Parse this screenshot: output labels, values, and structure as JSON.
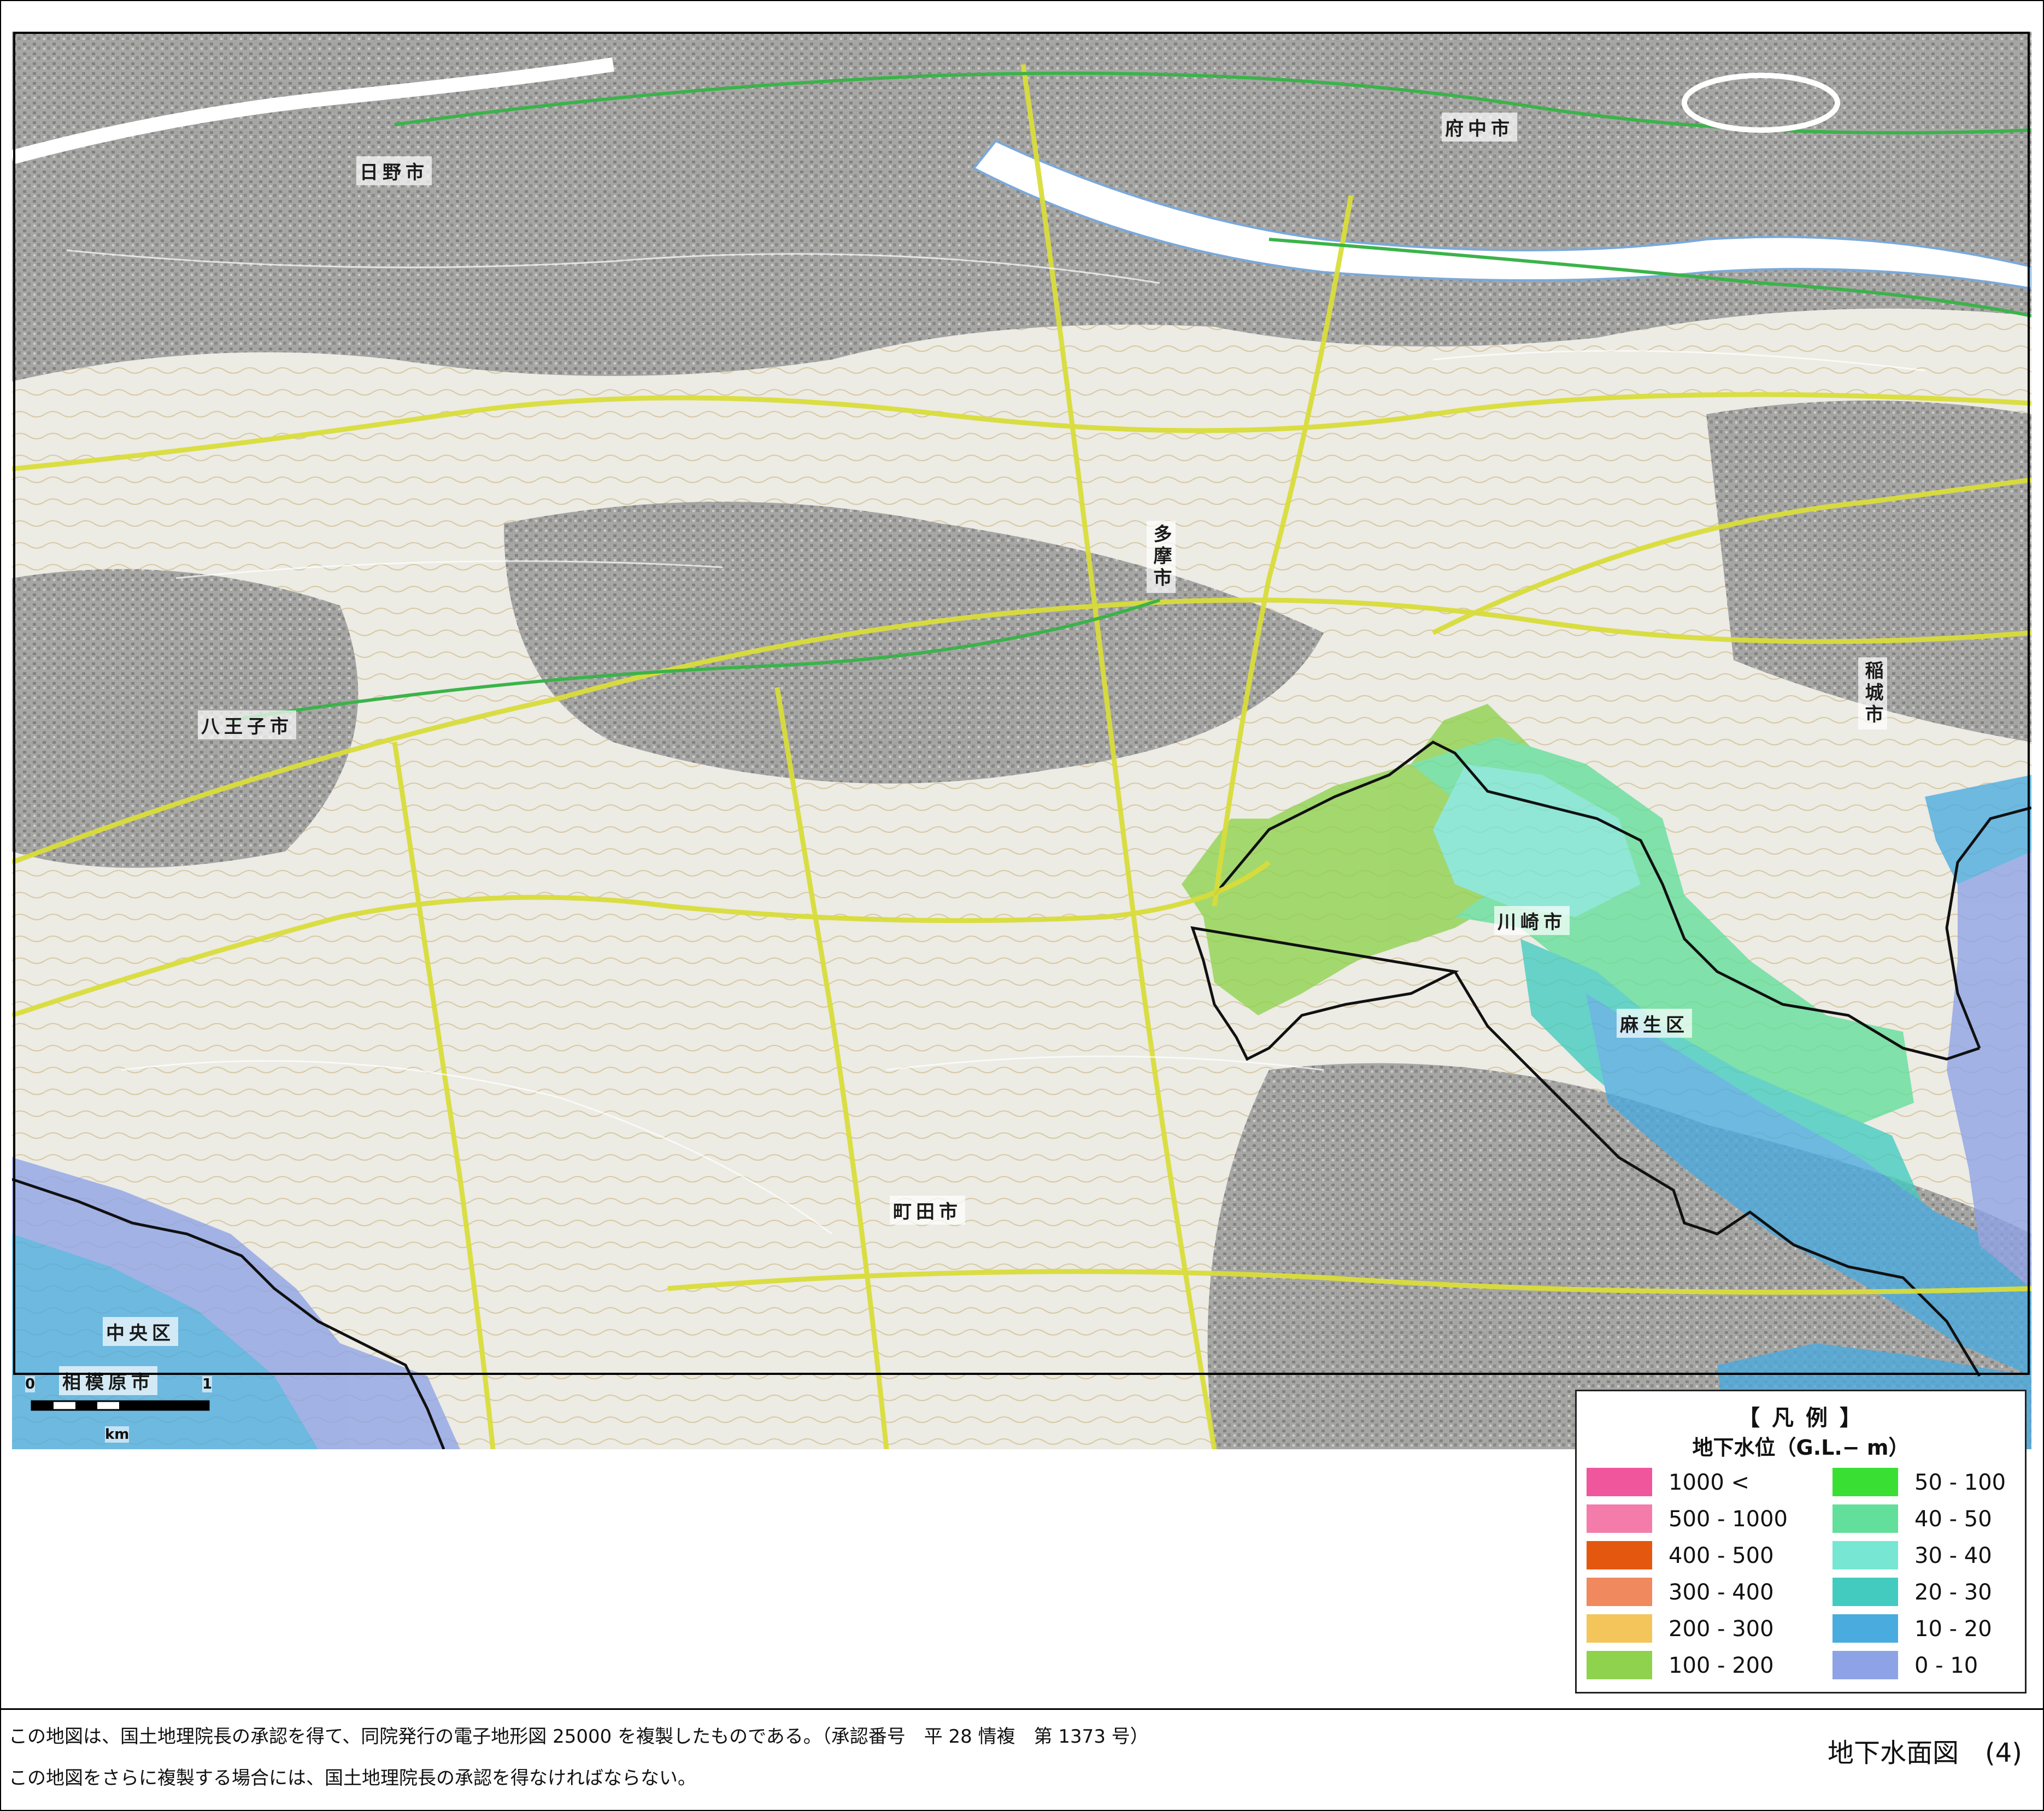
{
  "map": {
    "city_labels": [
      {
        "id": "hino",
        "text": "日野市"
      },
      {
        "id": "fuchu",
        "text": "府中市"
      },
      {
        "id": "tama",
        "text": "多摩市"
      },
      {
        "id": "hachioji",
        "text": "八王子市"
      },
      {
        "id": "inagi",
        "text": "稲城市"
      },
      {
        "id": "kawasaki",
        "text": "川崎市"
      },
      {
        "id": "asao",
        "text": "麻生区"
      },
      {
        "id": "machida",
        "text": "町田市"
      },
      {
        "id": "chuo",
        "text": "中央区"
      },
      {
        "id": "sagamihara",
        "text": "相模原市"
      }
    ],
    "colors": {
      "terrain": "#e9e9e6",
      "urban": "#8f8f8f",
      "road": "#d9dd3a",
      "river": "#ffffff",
      "rail": "#3bb34a"
    }
  },
  "scalebar": {
    "zero": "0",
    "one": "1",
    "unit": "km"
  },
  "legend": {
    "title": "【 凡 例 】",
    "subtitle": "地下水位（G.L.− m）",
    "items": [
      {
        "label": "1000 <",
        "color": "#f0569b"
      },
      {
        "label": "500 - 1000",
        "color": "#f47cab"
      },
      {
        "label": "400 - 500",
        "color": "#e4570f"
      },
      {
        "label": "300 - 400",
        "color": "#f0895e"
      },
      {
        "label": "200 - 300",
        "color": "#f3c55a"
      },
      {
        "label": "100 - 200",
        "color": "#8ed24d"
      },
      {
        "label": "50 - 100",
        "color": "#39e033"
      },
      {
        "label": "40 - 50",
        "color": "#62df9a"
      },
      {
        "label": "30 - 40",
        "color": "#77e6d3"
      },
      {
        "label": "20 - 30",
        "color": "#43cbc0"
      },
      {
        "label": "10 - 20",
        "color": "#4aabdf"
      },
      {
        "label": "0 - 10",
        "color": "#8ea3e6"
      }
    ]
  },
  "footer": {
    "credit_line1": "この地図は、国土地理院長の承認を得て、同院発行の電子地形図 25000 を複製したものである。（承認番号　平 28 情複　第 1373 号）",
    "credit_line2": "この地図をさらに複製する場合には、国土地理院長の承認を得なければならない。",
    "sheet_title": "地下水面図　(4)"
  }
}
